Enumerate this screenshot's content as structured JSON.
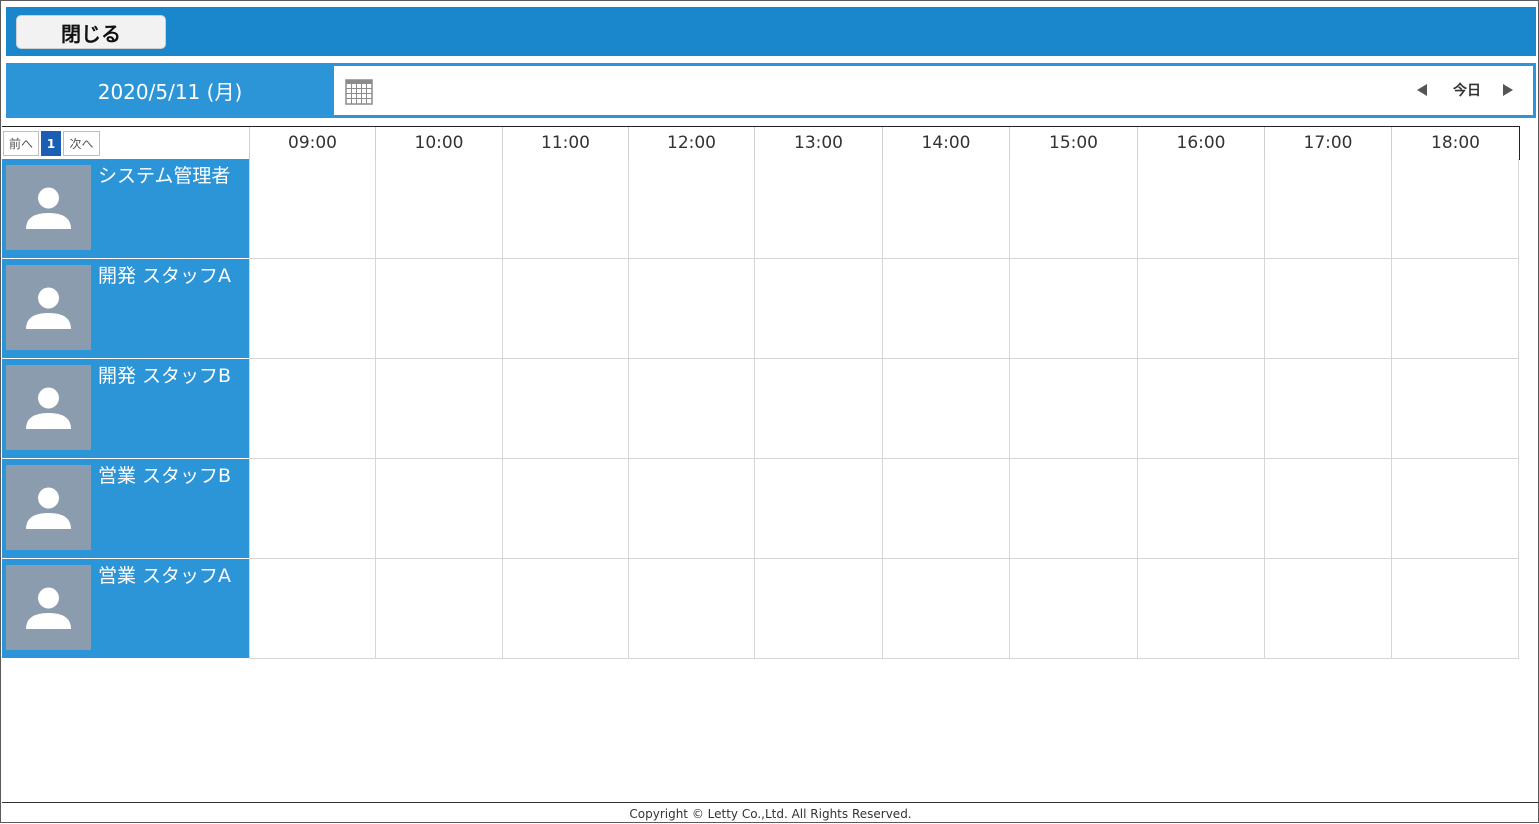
{
  "topbar": {
    "close_label": "閉じる",
    "bg_color": "#1a87cc"
  },
  "datebar": {
    "date": "2020/5/11 (月)",
    "calendar_icon": "calendar-icon",
    "today_label": "今日",
    "prev_icon": "triangle-left-icon",
    "next_icon": "triangle-right-icon"
  },
  "pager": {
    "prev": "前へ",
    "page": "1",
    "next": "次へ"
  },
  "hours": [
    "09:00",
    "10:00",
    "11:00",
    "12:00",
    "13:00",
    "14:00",
    "15:00",
    "16:00",
    "17:00",
    "18:00"
  ],
  "staff": [
    {
      "name": "システム管理者"
    },
    {
      "name": "開発 スタッフA"
    },
    {
      "name": "開発 スタッフB"
    },
    {
      "name": "営業 スタッフB"
    },
    {
      "name": "営業 スタッフA"
    }
  ],
  "footer": {
    "copyright": "Copyright © Letty Co.,Ltd. All Rights Reserved."
  },
  "colors": {
    "accent": "#2b95d7",
    "avatar_bg": "#8a9cad",
    "page_active": "#1a5fb4"
  }
}
